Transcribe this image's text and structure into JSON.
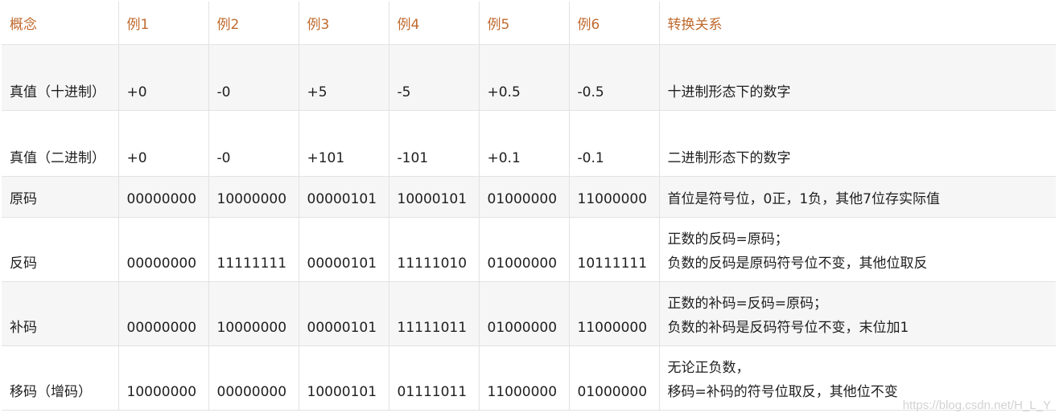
{
  "headers": [
    "概念",
    "例1",
    "例2",
    "例3",
    "例4",
    "例5",
    "例6",
    "转换关系"
  ],
  "rows": [
    {
      "concept": "真值（十进制）",
      "examples": [
        "+0",
        "-0",
        "+5",
        "-5",
        "+0.5",
        "-0.5"
      ],
      "relation": [
        "十进制形态下的数字"
      ]
    },
    {
      "concept": "真值（二进制）",
      "examples": [
        "+0",
        "-0",
        "+101",
        "-101",
        "+0.1",
        "-0.1"
      ],
      "relation": [
        "二进制形态下的数字"
      ]
    },
    {
      "concept": "原码",
      "examples": [
        "00000000",
        "10000000",
        "00000101",
        "10000101",
        "01000000",
        "11000000"
      ],
      "relation": [
        "首位是符号位，0正，1负，其他7位存实际值"
      ]
    },
    {
      "concept": "反码",
      "examples": [
        "00000000",
        "11111111",
        "00000101",
        "11111010",
        "01000000",
        "10111111"
      ],
      "relation": [
        "正数的反码=原码；",
        "负数的反码是原码符号位不变，其他位取反"
      ]
    },
    {
      "concept": "补码",
      "examples": [
        "00000000",
        "10000000",
        "00000101",
        "11111011",
        "01000000",
        "11000000"
      ],
      "relation": [
        "正数的补码=反码=原码；",
        "负数的补码是反码符号位不变，末位加1"
      ]
    },
    {
      "concept": "移码（增码）",
      "examples": [
        "10000000",
        "00000000",
        "10000101",
        "01111011",
        "11000000",
        "01000000"
      ],
      "relation": [
        "无论正负数，",
        "移码=补码的符号位取反，其他位不变"
      ]
    }
  ],
  "watermark": "https://blog.csdn.net/H_L_Y"
}
